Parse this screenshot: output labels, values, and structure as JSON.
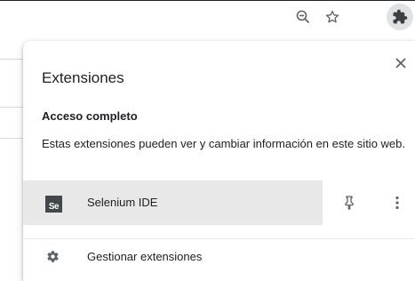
{
  "toolbar": {
    "zoom_icon": "zoom-out-magnifier",
    "star_icon": "bookmark-star",
    "extensions_icon": "puzzle-piece"
  },
  "popup": {
    "title": "Extensiones",
    "close_icon": "close-x",
    "section": {
      "heading": "Acceso completo",
      "description": "Estas extensiones pueden ver y cambiar información en este sitio web."
    },
    "extensions": [
      {
        "logo_text": "Se",
        "name": "Selenium IDE",
        "pin_icon": "pushpin",
        "menu_icon": "vertical-ellipsis"
      }
    ],
    "manage": {
      "icon": "gear",
      "label": "Gestionar extensiones"
    }
  },
  "colors": {
    "text": "#202124",
    "hover_row": "#e8e8e8",
    "icon": "#5f6368",
    "extensions_button_bg": "#e0e1e3"
  }
}
